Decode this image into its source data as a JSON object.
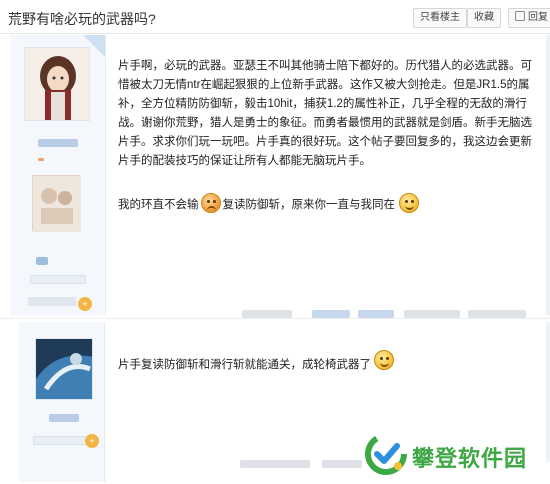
{
  "header": {
    "title": "荒野有啥必玩的武器吗?",
    "buttons": [
      {
        "label": "只看楼主",
        "icon": "eye-icon"
      },
      {
        "label": "收藏",
        "icon": "star-icon"
      },
      {
        "label": "回复",
        "icon": "reply-icon"
      }
    ]
  },
  "posts": [
    {
      "paragraph1": "片手啊，必玩的武器。亚瑟王不叫其他骑士陪下都好的。历代猎人的必选武器。可惜被太刀无情ntr在崛起狠狠的上位新手武器。这作又被大剑抢走。但是JR1.5的属补，全方位精防防御斩，毅击10hit，捕获1.2的属性补正，几乎全程的无敌的滑行战。谢谢你荒野，猎人是勇士的象征。而勇者最惯用的武器就是剑盾。新手无脑选片手。求求你们玩一玩吧。片手真的很好玩。这个帖子要回复多的，我这边会更新片手的配装技巧的保证让所有人都能无脑玩片手。",
      "line2_part1": "我的环直不会输",
      "line2_part2": "复读防御斩，原来你一直与我同在",
      "thumb": "+"
    },
    {
      "paragraph1": "片手复读防御斩和滑行斩就能通关，成轮椅武器了",
      "thumb": "+"
    }
  ],
  "watermark": {
    "text": "攀登软件园",
    "colors": {
      "green": "#3ea845",
      "blue": "#2f8fe0",
      "yellow": "#f2c230"
    }
  }
}
